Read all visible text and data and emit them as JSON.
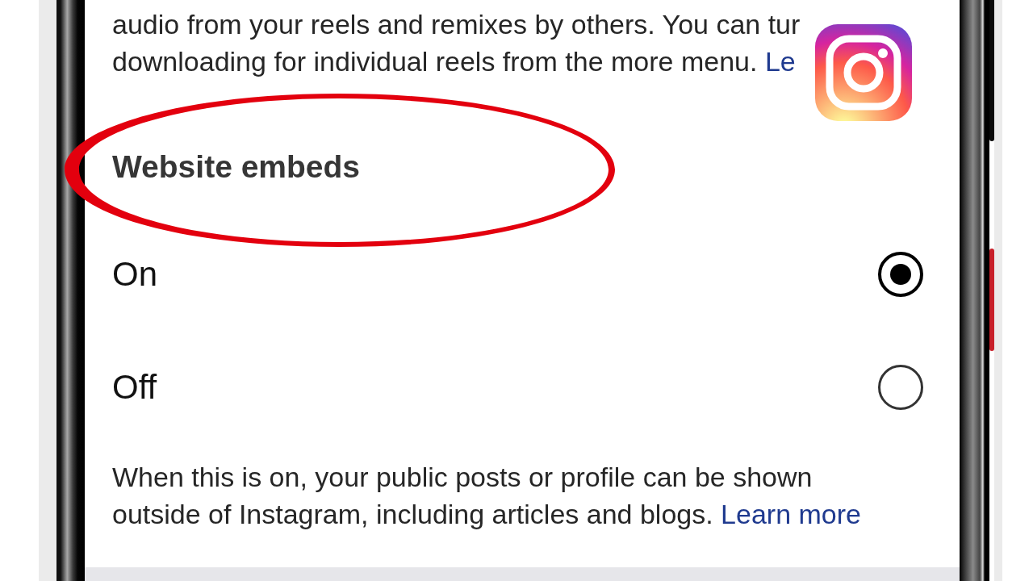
{
  "partial_text": {
    "lines": [
      {
        "text": "audio from your reels and remixes by others. You can tur"
      },
      {
        "text": "downloading for individual reels from the more menu.",
        "link": "Le"
      }
    ]
  },
  "section": {
    "title": "Website embeds"
  },
  "options": [
    {
      "label": "On",
      "selected": true
    },
    {
      "label": "Off",
      "selected": false
    }
  ],
  "description": {
    "text": "When this is on, your public posts or profile can be shown outside of Instagram, including articles and blogs.",
    "link": "Learn more"
  }
}
